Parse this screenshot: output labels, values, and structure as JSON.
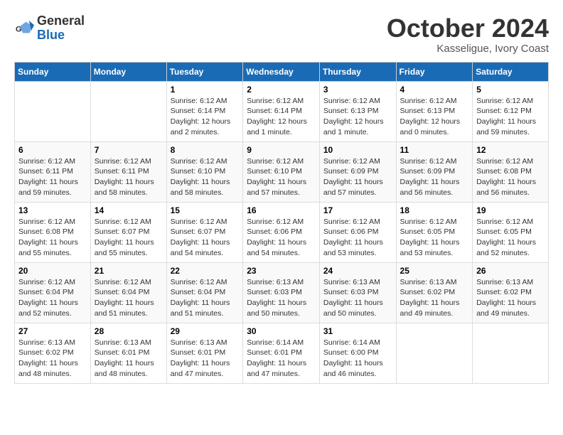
{
  "logo": {
    "line1": "General",
    "line2": "Blue"
  },
  "title": "October 2024",
  "location": "Kasseligue, Ivory Coast",
  "days_of_week": [
    "Sunday",
    "Monday",
    "Tuesday",
    "Wednesday",
    "Thursday",
    "Friday",
    "Saturday"
  ],
  "weeks": [
    [
      {
        "day": "",
        "info": ""
      },
      {
        "day": "",
        "info": ""
      },
      {
        "day": "1",
        "info": "Sunrise: 6:12 AM\nSunset: 6:14 PM\nDaylight: 12 hours\nand 2 minutes."
      },
      {
        "day": "2",
        "info": "Sunrise: 6:12 AM\nSunset: 6:14 PM\nDaylight: 12 hours\nand 1 minute."
      },
      {
        "day": "3",
        "info": "Sunrise: 6:12 AM\nSunset: 6:13 PM\nDaylight: 12 hours\nand 1 minute."
      },
      {
        "day": "4",
        "info": "Sunrise: 6:12 AM\nSunset: 6:13 PM\nDaylight: 12 hours\nand 0 minutes."
      },
      {
        "day": "5",
        "info": "Sunrise: 6:12 AM\nSunset: 6:12 PM\nDaylight: 11 hours\nand 59 minutes."
      }
    ],
    [
      {
        "day": "6",
        "info": "Sunrise: 6:12 AM\nSunset: 6:11 PM\nDaylight: 11 hours\nand 59 minutes."
      },
      {
        "day": "7",
        "info": "Sunrise: 6:12 AM\nSunset: 6:11 PM\nDaylight: 11 hours\nand 58 minutes."
      },
      {
        "day": "8",
        "info": "Sunrise: 6:12 AM\nSunset: 6:10 PM\nDaylight: 11 hours\nand 58 minutes."
      },
      {
        "day": "9",
        "info": "Sunrise: 6:12 AM\nSunset: 6:10 PM\nDaylight: 11 hours\nand 57 minutes."
      },
      {
        "day": "10",
        "info": "Sunrise: 6:12 AM\nSunset: 6:09 PM\nDaylight: 11 hours\nand 57 minutes."
      },
      {
        "day": "11",
        "info": "Sunrise: 6:12 AM\nSunset: 6:09 PM\nDaylight: 11 hours\nand 56 minutes."
      },
      {
        "day": "12",
        "info": "Sunrise: 6:12 AM\nSunset: 6:08 PM\nDaylight: 11 hours\nand 56 minutes."
      }
    ],
    [
      {
        "day": "13",
        "info": "Sunrise: 6:12 AM\nSunset: 6:08 PM\nDaylight: 11 hours\nand 55 minutes."
      },
      {
        "day": "14",
        "info": "Sunrise: 6:12 AM\nSunset: 6:07 PM\nDaylight: 11 hours\nand 55 minutes."
      },
      {
        "day": "15",
        "info": "Sunrise: 6:12 AM\nSunset: 6:07 PM\nDaylight: 11 hours\nand 54 minutes."
      },
      {
        "day": "16",
        "info": "Sunrise: 6:12 AM\nSunset: 6:06 PM\nDaylight: 11 hours\nand 54 minutes."
      },
      {
        "day": "17",
        "info": "Sunrise: 6:12 AM\nSunset: 6:06 PM\nDaylight: 11 hours\nand 53 minutes."
      },
      {
        "day": "18",
        "info": "Sunrise: 6:12 AM\nSunset: 6:05 PM\nDaylight: 11 hours\nand 53 minutes."
      },
      {
        "day": "19",
        "info": "Sunrise: 6:12 AM\nSunset: 6:05 PM\nDaylight: 11 hours\nand 52 minutes."
      }
    ],
    [
      {
        "day": "20",
        "info": "Sunrise: 6:12 AM\nSunset: 6:04 PM\nDaylight: 11 hours\nand 52 minutes."
      },
      {
        "day": "21",
        "info": "Sunrise: 6:12 AM\nSunset: 6:04 PM\nDaylight: 11 hours\nand 51 minutes."
      },
      {
        "day": "22",
        "info": "Sunrise: 6:12 AM\nSunset: 6:04 PM\nDaylight: 11 hours\nand 51 minutes."
      },
      {
        "day": "23",
        "info": "Sunrise: 6:13 AM\nSunset: 6:03 PM\nDaylight: 11 hours\nand 50 minutes."
      },
      {
        "day": "24",
        "info": "Sunrise: 6:13 AM\nSunset: 6:03 PM\nDaylight: 11 hours\nand 50 minutes."
      },
      {
        "day": "25",
        "info": "Sunrise: 6:13 AM\nSunset: 6:02 PM\nDaylight: 11 hours\nand 49 minutes."
      },
      {
        "day": "26",
        "info": "Sunrise: 6:13 AM\nSunset: 6:02 PM\nDaylight: 11 hours\nand 49 minutes."
      }
    ],
    [
      {
        "day": "27",
        "info": "Sunrise: 6:13 AM\nSunset: 6:02 PM\nDaylight: 11 hours\nand 48 minutes."
      },
      {
        "day": "28",
        "info": "Sunrise: 6:13 AM\nSunset: 6:01 PM\nDaylight: 11 hours\nand 48 minutes."
      },
      {
        "day": "29",
        "info": "Sunrise: 6:13 AM\nSunset: 6:01 PM\nDaylight: 11 hours\nand 47 minutes."
      },
      {
        "day": "30",
        "info": "Sunrise: 6:14 AM\nSunset: 6:01 PM\nDaylight: 11 hours\nand 47 minutes."
      },
      {
        "day": "31",
        "info": "Sunrise: 6:14 AM\nSunset: 6:00 PM\nDaylight: 11 hours\nand 46 minutes."
      },
      {
        "day": "",
        "info": ""
      },
      {
        "day": "",
        "info": ""
      }
    ]
  ]
}
